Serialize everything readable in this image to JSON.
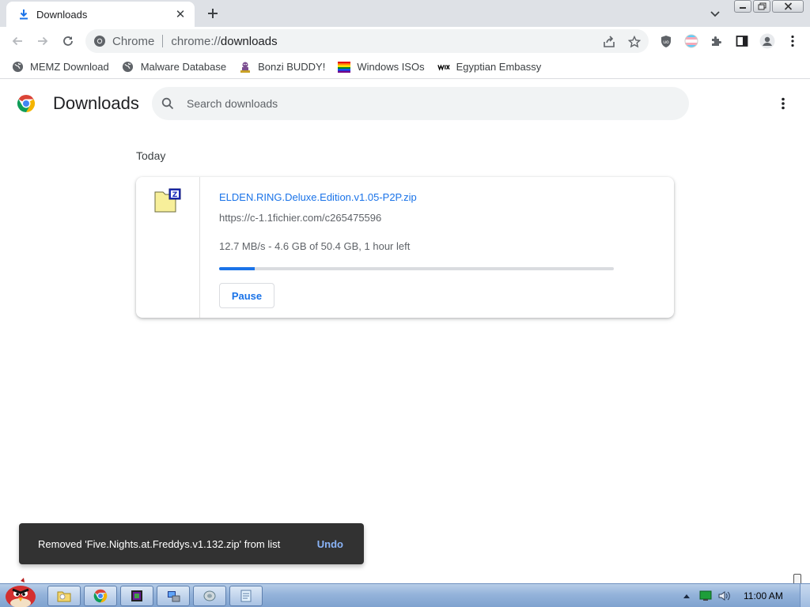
{
  "tab": {
    "title": "Downloads",
    "close_glyph": "✕",
    "new_tab_glyph": "+"
  },
  "toolbar": {
    "site_label": "Chrome",
    "url_scheme": "chrome://",
    "url_path": "downloads"
  },
  "bookmarks": [
    {
      "label": "MEMZ Download",
      "icon": "globe-icon"
    },
    {
      "label": "Malware Database",
      "icon": "globe-icon"
    },
    {
      "label": "Bonzi BUDDY!",
      "icon": "bonzi-icon"
    },
    {
      "label": "Windows ISOs",
      "icon": "rainbow-flag-icon"
    },
    {
      "label": "Egyptian Embassy",
      "icon": "wix-icon"
    }
  ],
  "page": {
    "title": "Downloads",
    "search_placeholder": "Search downloads",
    "section_label": "Today"
  },
  "download": {
    "filename": "ELDEN.RING.Deluxe.Edition.v1.05-P2P.zip",
    "url": "https://c-1.1fichier.com/c265475596",
    "status": "12.7 MB/s - 4.6 GB of 50.4 GB, 1 hour left",
    "progress_fraction": 0.091,
    "pause_label": "Pause"
  },
  "toast": {
    "message": "Removed 'Five.Nights.at.Freddys.v1.132.zip' from list",
    "action_label": "Undo"
  },
  "taskbar": {
    "clock": "11:00 AM",
    "items": [
      "explorer-icon",
      "chrome-icon",
      "app-icon",
      "setup-icon",
      "network-drive-icon",
      "notepad-icon"
    ]
  },
  "colors": {
    "accent": "#1a73e8",
    "toast_bg": "#323232",
    "undo": "#8ab4f8"
  }
}
